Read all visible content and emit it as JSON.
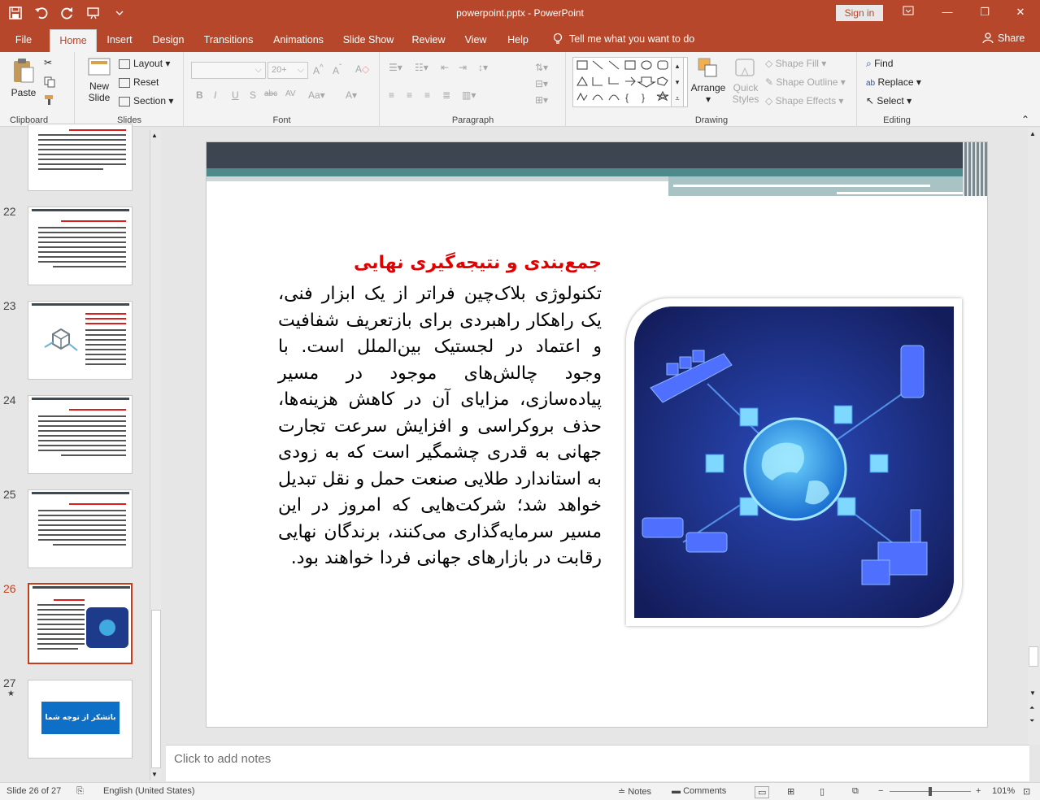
{
  "window": {
    "title": "powerpoint.pptx  -  PowerPoint",
    "signin": "Sign in"
  },
  "tabs": [
    "File",
    "Home",
    "Insert",
    "Design",
    "Transitions",
    "Animations",
    "Slide Show",
    "Review",
    "View",
    "Help"
  ],
  "tellme": "Tell me what you want to do",
  "share": "Share",
  "ribbon": {
    "clipboard": {
      "label": "Clipboard",
      "paste": "Paste"
    },
    "slides": {
      "label": "Slides",
      "new_slide_1": "New",
      "new_slide_2": "Slide",
      "layout": "Layout",
      "reset": "Reset",
      "section": "Section"
    },
    "font": {
      "label": "Font",
      "size": "20+"
    },
    "paragraph": {
      "label": "Paragraph"
    },
    "drawing": {
      "label": "Drawing",
      "arrange": "Arrange",
      "quick_1": "Quick",
      "quick_2": "Styles",
      "shape_fill": "Shape Fill",
      "shape_outline": "Shape Outline",
      "shape_effects": "Shape Effects"
    },
    "editing": {
      "label": "Editing",
      "find": "Find",
      "replace": "Replace",
      "select": "Select"
    }
  },
  "thumbnails": [
    {
      "num": "22",
      "title": "مقاومت در برابر تغییر و فرهنگ سازمانی"
    },
    {
      "num": "23",
      "title": ""
    },
    {
      "num": "24",
      "title": ""
    },
    {
      "num": "25",
      "title": ""
    },
    {
      "num": "26",
      "title": "جمع‌بندی و نتیجه‌گیری نهایی"
    },
    {
      "num": "27",
      "star": "★",
      "title": "باتشکر از توجه شما"
    }
  ],
  "slide": {
    "heading": "جمع‌بندی و نتیجه‌گیری نهایی",
    "body": "تکنولوژی بلاک‌چین فراتر از یک ابزار فنی، یک راهکار راهبردی برای بازتعریف شفافیت و اعتماد در لجستیک بین‌الملل است. با وجود چالش‌های موجود در مسیر پیاده‌سازی، مزایای آن در کاهش هزینه‌ها، حذف بروکراسی و افزایش سرعت تجارت جهانی به قدری چشمگیر است که به زودی به استاندارد طلایی صنعت حمل و نقل تبدیل خواهد شد؛ شرکت‌هایی که امروز در این مسیر سرمایه‌گذاری می‌کنند، برندگان نهایی رقابت در بازارهای جهانی فردا خواهند بود."
  },
  "notes_placeholder": "Click to add notes",
  "status": {
    "slide_info": "Slide 26 of 27",
    "language": "English (United States)",
    "notes": "Notes",
    "comments": "Comments",
    "zoom": "101%"
  },
  "colors": {
    "accent": "#b7472a",
    "selected": "#c43e1c",
    "heading_red": "#e00000",
    "banner_dark": "#3c4550",
    "banner_teal": "#4e8a8c"
  }
}
